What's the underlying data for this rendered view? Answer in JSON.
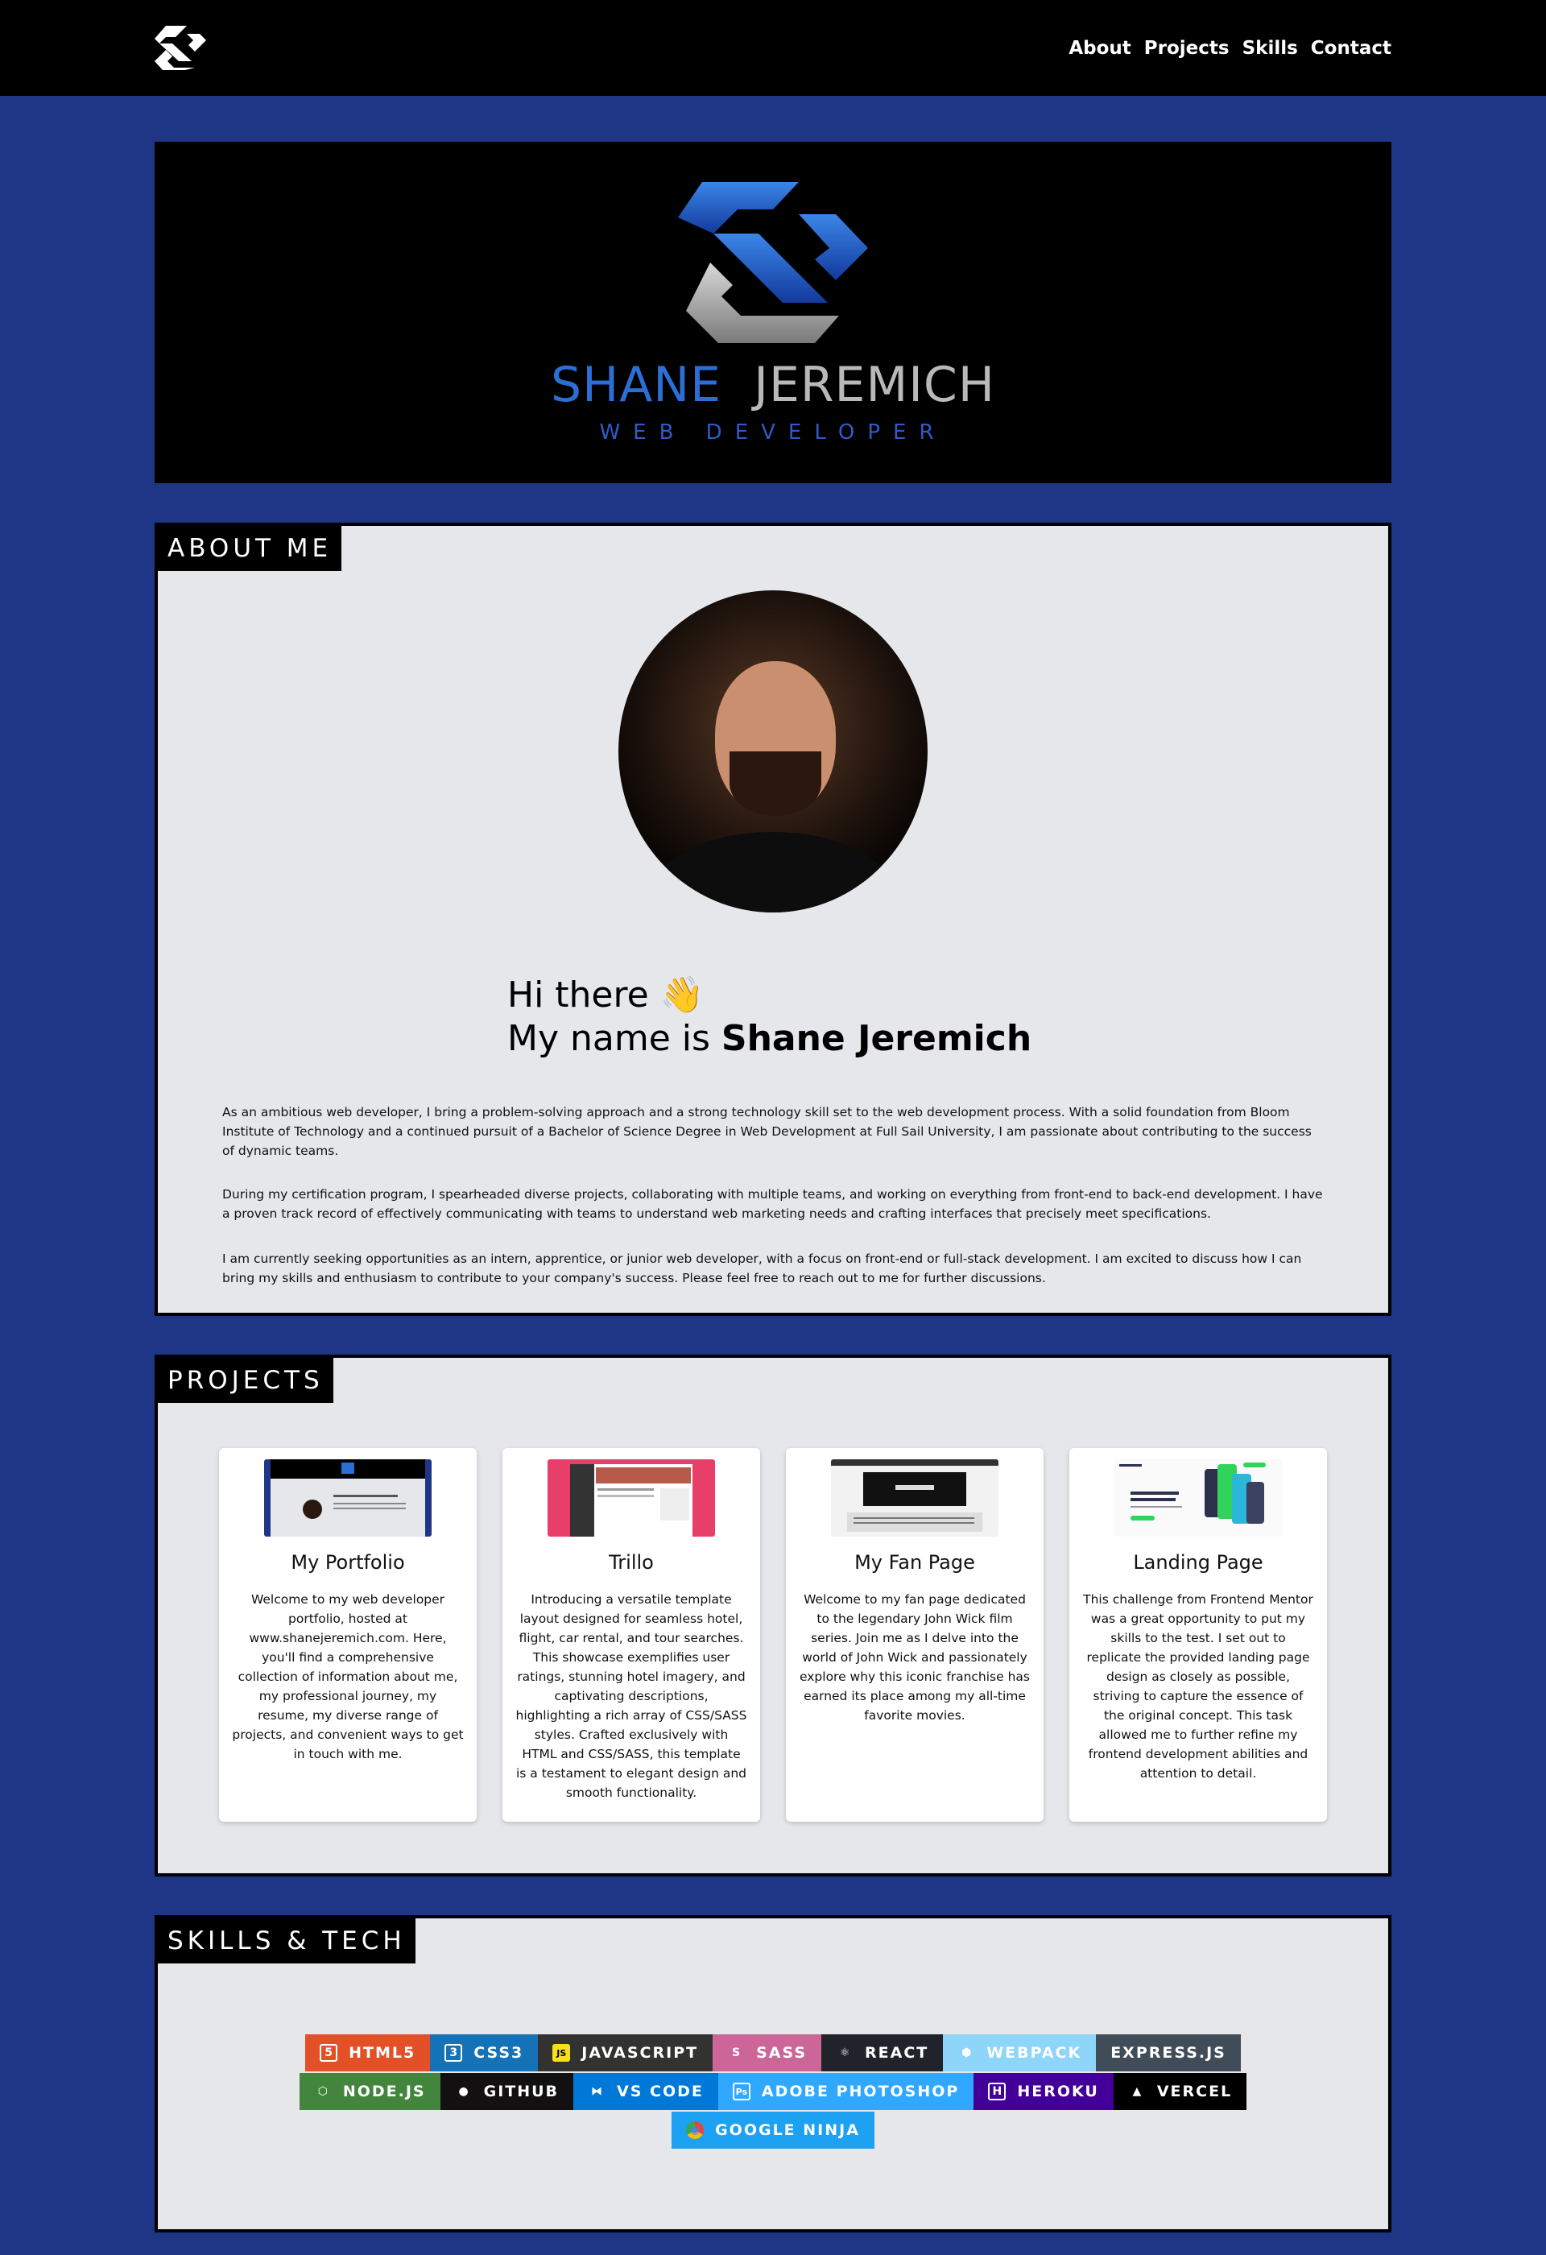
{
  "nav": {
    "logo_icon": "sj-logo-icon",
    "links": [
      "About",
      "Projects",
      "Skills",
      "Contact"
    ]
  },
  "hero": {
    "first_name": "SHANE",
    "last_name": "JEREMICH",
    "subtitle": "WEB DEVELOPER",
    "logo_icon": "sj-logo-icon"
  },
  "about": {
    "label": "ABOUT ME",
    "greeting_line1": "Hi there 👋",
    "greeting_prefix": "My name is ",
    "greeting_name": "Shane Jeremich",
    "paragraphs": [
      "As an ambitious web developer, I bring a problem-solving approach and a strong technology skill set to the web development process. With a solid foundation from Bloom Institute of Technology and a continued pursuit of a Bachelor of Science Degree in Web Development at Full Sail University, I am passionate about contributing to the success of dynamic teams.",
      "During my certification program, I spearheaded diverse projects, collaborating with multiple teams, and working on everything from front-end to back-end development. I have a proven track record of effectively communicating with teams to understand web marketing needs and crafting interfaces that precisely meet specifications.",
      "I am currently seeking opportunities as an intern, apprentice, or junior web developer, with a focus on front-end or full-stack development. I am excited to discuss how I can bring my skills and enthusiasm to contribute to your company's success. Please feel free to reach out to me for further discussions."
    ]
  },
  "projects": {
    "label": "PROJECTS",
    "items": [
      {
        "title": "My Portfolio",
        "description": "Welcome to my web developer portfolio, hosted at www.shanejeremich.com. Here, you'll find a comprehensive collection of information about me, my professional journey, my resume, my diverse range of projects, and convenient ways to get in touch with me."
      },
      {
        "title": "Trillo",
        "description": "Introducing a versatile template layout designed for seamless hotel, flight, car rental, and tour searches. This showcase exemplifies user ratings, stunning hotel imagery, and captivating descriptions, highlighting a rich array of CSS/SASS styles. Crafted exclusively with HTML and CSS/SASS, this template is a testament to elegant design and smooth functionality."
      },
      {
        "title": "My Fan Page",
        "description": "Welcome to my fan page dedicated to the legendary John Wick film series. Join me as I delve into the world of John Wick and passionately explore why this iconic franchise has earned its place among my all-time favorite movies."
      },
      {
        "title": "Landing Page",
        "description": "This challenge from Frontend Mentor was a great opportunity to put my skills to the test. I set out to replicate the provided landing page design as closely as possible, striving to capture the essence of the original concept. This task allowed me to further refine my frontend development abilities and attention to detail."
      }
    ]
  },
  "skills": {
    "label": "SKILLS & TECH",
    "rows": [
      [
        {
          "label": "HTML5",
          "bg": "#e34f26",
          "icon": "html5-icon",
          "glyph": "5"
        },
        {
          "label": "CSS3",
          "bg": "#1572b6",
          "icon": "css3-icon",
          "glyph": "3"
        },
        {
          "label": "JAVASCRIPT",
          "bg": "#323330",
          "icon": "javascript-icon",
          "glyph": "JS"
        },
        {
          "label": "SASS",
          "bg": "#cc6699",
          "icon": "sass-icon",
          "glyph": "S"
        },
        {
          "label": "REACT",
          "bg": "#20232a",
          "icon": "react-icon",
          "glyph": "⚛"
        },
        {
          "label": "WEBPACK",
          "bg": "#8dd6f9",
          "icon": "webpack-icon",
          "glyph": "⬢"
        },
        {
          "label": "EXPRESS.JS",
          "bg": "#404d59",
          "icon": "",
          "glyph": ""
        }
      ],
      [
        {
          "label": "NODE.JS",
          "bg": "#43853d",
          "icon": "nodejs-icon",
          "glyph": "⬡"
        },
        {
          "label": "GITHUB",
          "bg": "#121011",
          "icon": "github-icon",
          "glyph": "●"
        },
        {
          "label": "VS CODE",
          "bg": "#0078d7",
          "icon": "vscode-icon",
          "glyph": "⧓"
        },
        {
          "label": "ADOBE PHOTOSHOP",
          "bg": "#31a8ff",
          "icon": "photoshop-icon",
          "glyph": "Ps"
        },
        {
          "label": "HEROKU",
          "bg": "#430098",
          "icon": "heroku-icon",
          "glyph": "H"
        },
        {
          "label": "VERCEL",
          "bg": "#000000",
          "icon": "vercel-icon",
          "glyph": "▲"
        }
      ],
      [
        {
          "label": "GOOGLE NINJA",
          "bg": "#1da1f2",
          "icon": "google-chrome-icon",
          "glyph": "◉"
        }
      ]
    ]
  },
  "colors": {
    "page_bg": "#1e3685",
    "section_bg": "#e5e7eb",
    "hero_blue": "#2b6fd6",
    "hero_gray": "#b9b9b9"
  }
}
